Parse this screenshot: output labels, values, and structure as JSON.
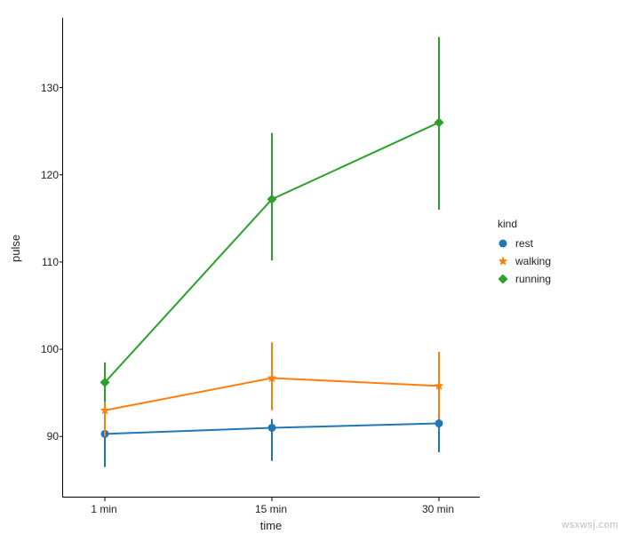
{
  "chart_data": {
    "type": "line",
    "title": "",
    "xlabel": "time",
    "ylabel": "pulse",
    "categories": [
      "1 min",
      "15 min",
      "30 min"
    ],
    "yticks": [
      90,
      100,
      110,
      120,
      130
    ],
    "ylim": [
      83,
      138
    ],
    "legend_title": "kind",
    "legend_position": "right",
    "series": [
      {
        "name": "rest",
        "color": "#1f77b4",
        "marker": "circle",
        "values": [
          90.3,
          91.0,
          91.5
        ],
        "err_low": [
          86.5,
          87.2,
          88.2
        ],
        "err_high": [
          91.5,
          92.0,
          92.3
        ]
      },
      {
        "name": "walking",
        "color": "#ff7f0e",
        "marker": "star",
        "values": [
          93.0,
          96.7,
          95.8
        ],
        "err_low": [
          90.0,
          93.0,
          92.0
        ],
        "err_high": [
          95.5,
          100.8,
          99.7
        ]
      },
      {
        "name": "running",
        "color": "#2ca02c",
        "marker": "diamond",
        "values": [
          96.2,
          117.2,
          126.0
        ],
        "err_low": [
          94.0,
          110.2,
          116.0
        ],
        "err_high": [
          98.5,
          124.8,
          135.8
        ]
      }
    ]
  },
  "watermark": "wsxwsj.com"
}
